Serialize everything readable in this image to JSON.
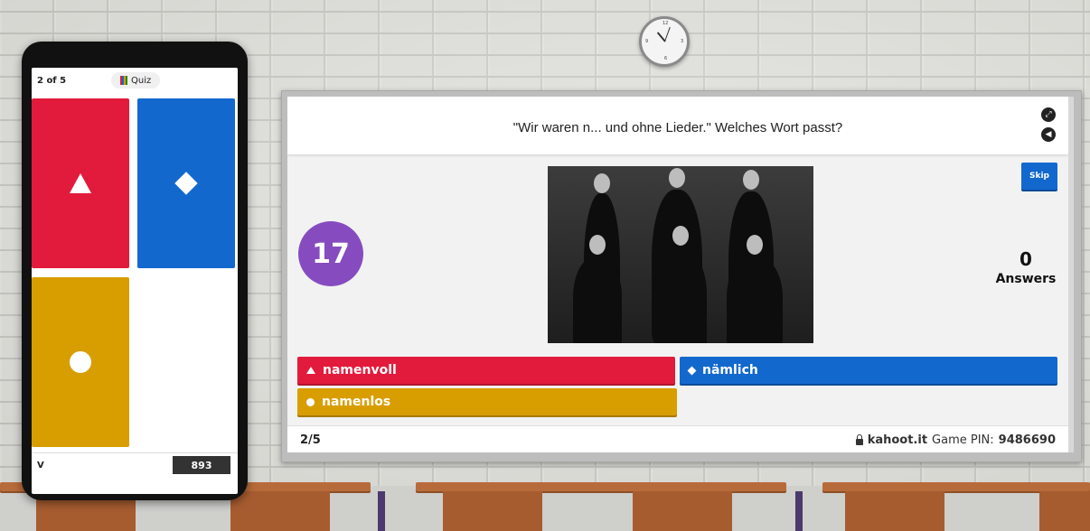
{
  "phone": {
    "question_counter": "2 of 5",
    "quiz_label": "Quiz",
    "player_name": "V",
    "score": "893"
  },
  "board": {
    "question": "\"Wir waren n... und ohne Lieder.\" Welches Wort passt?",
    "timer": "17",
    "skip_label": "Skip",
    "answers_count": "0",
    "answers_label": "Answers",
    "answers": [
      {
        "text": "namenvoll",
        "color": "#e21b3c",
        "shape": "triangle"
      },
      {
        "text": "nämlich",
        "color": "#1368ce",
        "shape": "diamond"
      },
      {
        "text": "namenlos",
        "color": "#d89e00",
        "shape": "circle"
      }
    ],
    "progress": "2/5",
    "site": "kahoot.it",
    "pin_label": "Game PIN:",
    "pin": "9486690"
  },
  "icons": {
    "fullscreen": "fullscreen-icon",
    "volume": "volume-icon",
    "lock": "lock-icon"
  },
  "colors": {
    "red": "#e21b3c",
    "blue": "#1368ce",
    "yellow": "#d89e00",
    "purple": "#864cbf"
  }
}
